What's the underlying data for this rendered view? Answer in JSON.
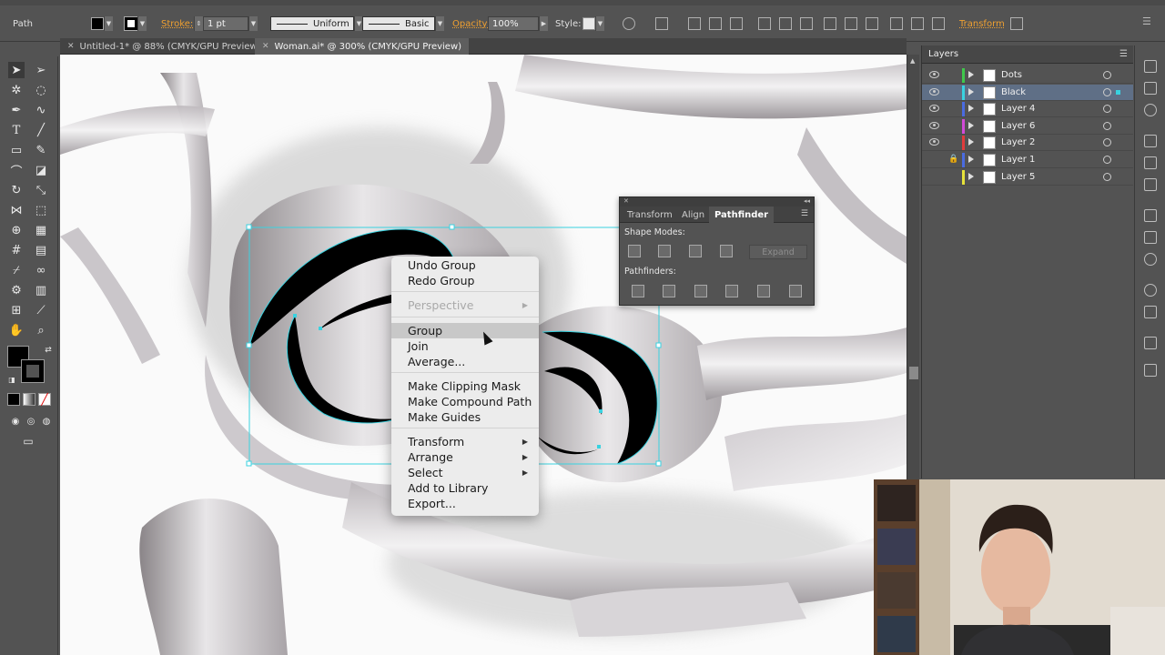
{
  "control_bar": {
    "selection_type": "Path",
    "stroke_label": "Stroke:",
    "stroke_weight": "1 pt",
    "profile": "Uniform",
    "brush": "Basic",
    "opacity_label": "Opacity:",
    "opacity_value": "100%",
    "style_label": "Style:",
    "transform_label": "Transform"
  },
  "tabs": [
    {
      "label": "Untitled-1* @ 88% (CMYK/GPU Preview)",
      "active": false
    },
    {
      "label": "Woman.ai* @ 300% (CMYK/GPU Preview)",
      "active": true
    }
  ],
  "context_menu": {
    "items": [
      {
        "label": "Undo Group",
        "disabled": false
      },
      {
        "label": "Redo Group",
        "disabled": false
      },
      {
        "label": "Perspective",
        "disabled": true,
        "submenu": true
      },
      {
        "label": "Group",
        "disabled": false,
        "hover": true
      },
      {
        "label": "Join",
        "disabled": false
      },
      {
        "label": "Average...",
        "disabled": false
      },
      {
        "label": "Make Clipping Mask",
        "disabled": false
      },
      {
        "label": "Make Compound Path",
        "disabled": false
      },
      {
        "label": "Make Guides",
        "disabled": false
      },
      {
        "label": "Transform",
        "disabled": false,
        "submenu": true
      },
      {
        "label": "Arrange",
        "disabled": false,
        "submenu": true
      },
      {
        "label": "Select",
        "disabled": false,
        "submenu": true
      },
      {
        "label": "Add to Library",
        "disabled": false
      },
      {
        "label": "Export...",
        "disabled": false
      }
    ]
  },
  "pathfinder_panel": {
    "tabs": [
      "Transform",
      "Align",
      "Pathfinder"
    ],
    "active_tab": "Pathfinder",
    "shape_modes_label": "Shape Modes:",
    "pathfinders_label": "Pathfinders:",
    "expand_label": "Expand"
  },
  "layers_panel": {
    "title": "Layers",
    "layers": [
      {
        "name": "Dots",
        "color": "#3fc84b",
        "visible": true,
        "locked": false,
        "selected": false
      },
      {
        "name": "Black",
        "color": "#39d2e0",
        "visible": true,
        "locked": false,
        "selected": true
      },
      {
        "name": "Layer 4",
        "color": "#4a6be0",
        "visible": true,
        "locked": false,
        "selected": false
      },
      {
        "name": "Layer 6",
        "color": "#d24ad8",
        "visible": true,
        "locked": false,
        "selected": false
      },
      {
        "name": "Layer 2",
        "color": "#e03c3c",
        "visible": true,
        "locked": false,
        "selected": false
      },
      {
        "name": "Layer 1",
        "color": "#4a6be0",
        "visible": false,
        "locked": true,
        "selected": false
      },
      {
        "name": "Layer 5",
        "color": "#e6e23a",
        "visible": false,
        "locked": false,
        "selected": false
      }
    ]
  },
  "colors": {
    "selection_accent": "#39d2e0",
    "ui_dark": "#535353",
    "menu_bg": "#ececec"
  }
}
